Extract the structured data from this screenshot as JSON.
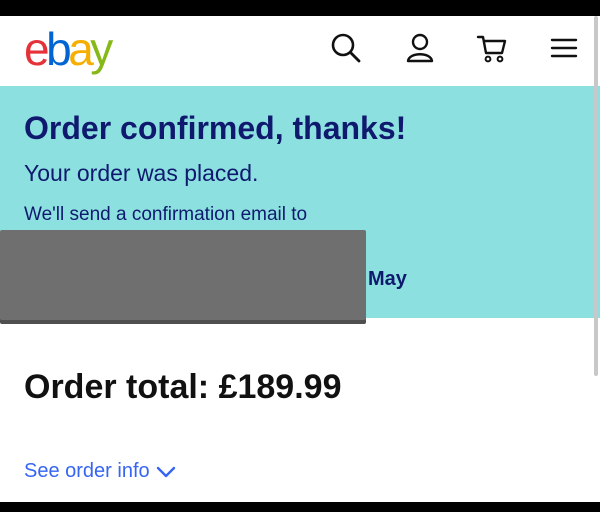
{
  "header": {
    "logo": {
      "e": "e",
      "b": "b",
      "a": "a",
      "y": "y"
    },
    "icons": [
      "search-icon",
      "account-icon",
      "cart-icon",
      "menu-icon"
    ]
  },
  "banner": {
    "title": "Order confirmed, thanks!",
    "subtitle": "Your order was placed.",
    "email_line": "We'll send a confirmation email to",
    "tail": "May",
    "background": "#8de0e0",
    "text_color": "#0f1a6e"
  },
  "order": {
    "total": "Order total: £189.99"
  },
  "links": {
    "see_order_info": "See order info"
  },
  "colors": {
    "link": "#3665f3",
    "ebay_e": "#e53238",
    "ebay_b": "#0064d2",
    "ebay_a": "#f5af02",
    "ebay_y": "#86b817"
  }
}
